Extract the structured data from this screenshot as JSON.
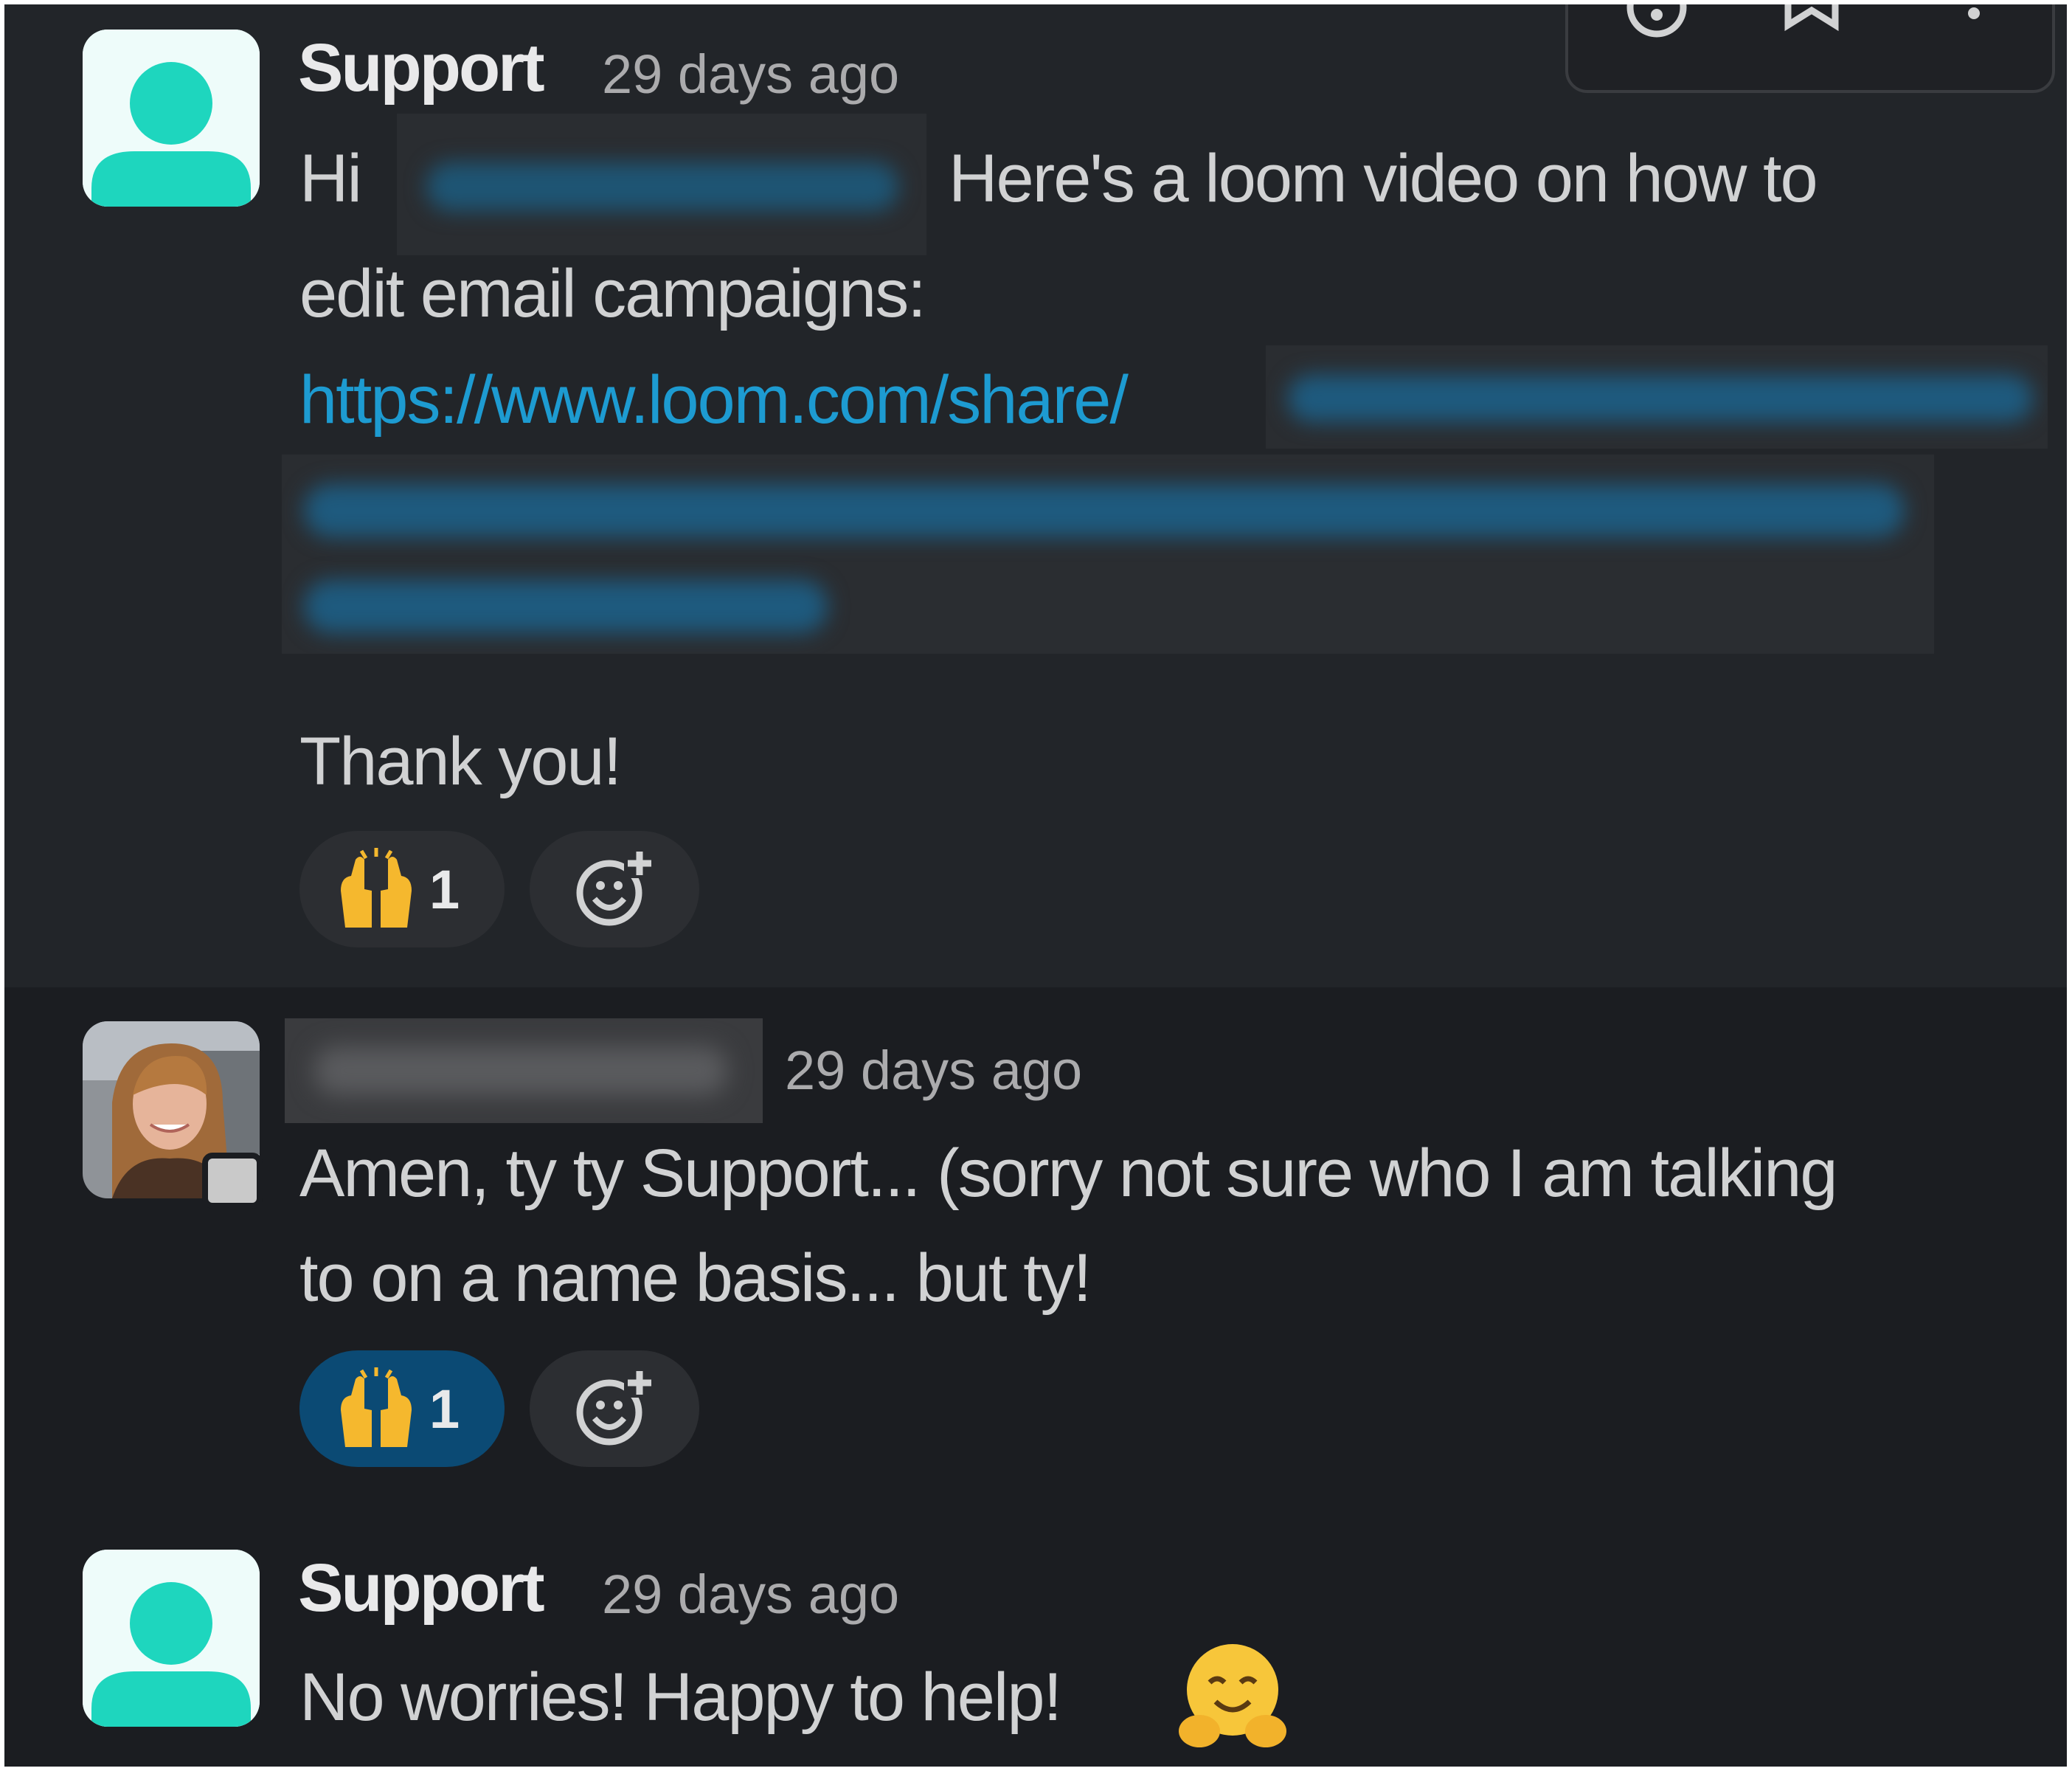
{
  "toolbar": {
    "icons": [
      "emoji-reaction-icon",
      "bookmark-icon",
      "more-actions-icon"
    ]
  },
  "messages": [
    {
      "author": "Support",
      "time": "29 days ago",
      "greeting": "Hi",
      "line1_rest": "Here's a loom video on how to",
      "line2": "edit email campaigns:",
      "link_text": "https://www.loom.com/share/",
      "closing": "Thank you!",
      "reaction": {
        "emoji": "raised-hands-icon",
        "count": "1"
      }
    },
    {
      "author": "",
      "time": "29 days ago",
      "line1": "Amen, ty ty Support... (sorry not sure who I am talking",
      "line2": "to on a name basis... but ty!",
      "reaction": {
        "emoji": "raised-hands-icon",
        "count": "1"
      }
    },
    {
      "author": "Support",
      "time": "29 days ago",
      "text": "No worries! Happy to help!",
      "emoji": "hugging-face-icon"
    }
  ],
  "colors": {
    "background": "#1b1d21",
    "hover_background": "#222529",
    "link": "#1d9bd1",
    "avatar_accent": "#1ed6be",
    "active_reaction": "#0b4a74"
  }
}
